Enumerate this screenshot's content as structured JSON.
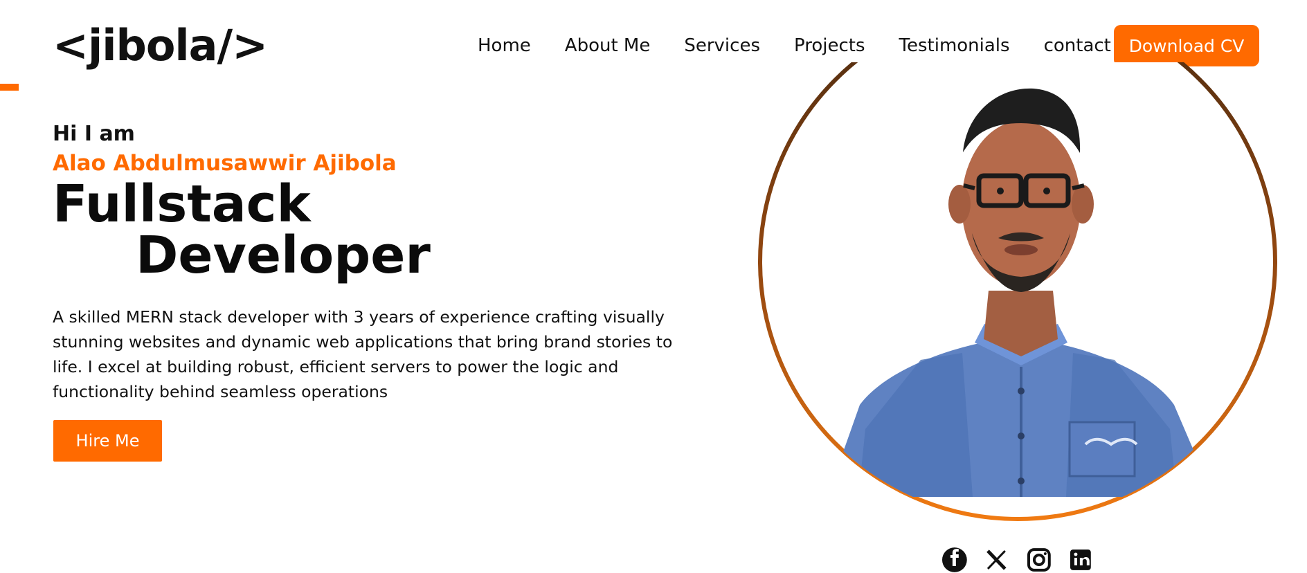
{
  "logo": "<jibola/>",
  "nav": {
    "items": [
      "Home",
      "About Me",
      "Services",
      "Projects",
      "Testimonials",
      "contact"
    ],
    "cta_label": "Download CV"
  },
  "hero": {
    "greeting": "Hi I am",
    "name": "Alao Abdulmusawwir Ajibola",
    "title_line1": "Fullstack",
    "title_line2": "Developer",
    "bio": "A skilled MERN stack developer with 3 years of experience crafting visually stunning websites and dynamic web applications that bring brand stories to life. I excel at building robust, efficient servers to power the logic and functionality behind seamless operations",
    "hire_label": "Hire Me"
  },
  "portrait": {
    "icon": "person-portrait"
  },
  "socials": {
    "icons": [
      "facebook-icon",
      "x-icon",
      "instagram-icon",
      "linkedin-icon"
    ]
  },
  "colors": {
    "accent": "#ff6a00",
    "ring_top": "#4a2a10",
    "ring_bottom": "#f07a12"
  }
}
